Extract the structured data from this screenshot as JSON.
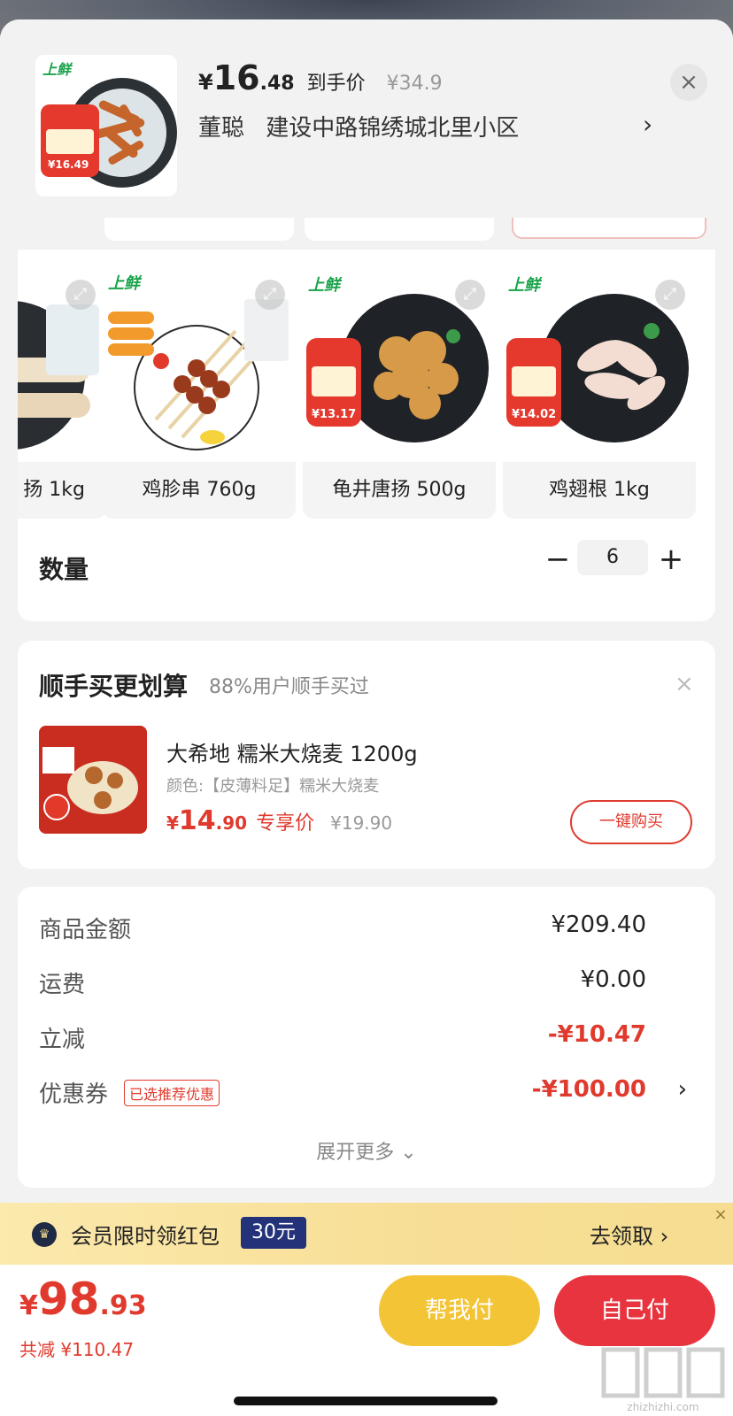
{
  "header": {
    "price_currency": "¥",
    "price_int": "16",
    "price_dec": ".48",
    "price_tag": "到手价",
    "orig_price": "¥34.9",
    "close_glyph": "×",
    "address_name": "董聪",
    "address_detail": "建设中路锦绣城北里小区",
    "chevron": "›",
    "thumb_brand": "上鲜",
    "thumb_badge_price": "¥16.49"
  },
  "products": [
    {
      "name": "扬 1kg",
      "brand": "",
      "badge_price": ""
    },
    {
      "name": "鸡胗串 760g",
      "brand": "上鲜",
      "badge_price": ""
    },
    {
      "name": "龟井唐扬 500g",
      "brand": "上鲜",
      "badge_price": "¥13.17"
    },
    {
      "name": "鸡翅根 1kg",
      "brand": "上鲜",
      "badge_price": "¥14.02"
    }
  ],
  "quantity": {
    "label": "数量",
    "minus": "−",
    "value": "6",
    "plus": "+"
  },
  "upsell": {
    "title": "顺手买更划算",
    "subtitle": "88%用户顺手买过",
    "close_glyph": "×",
    "name": "大希地 糯米大烧麦 1200g",
    "spec": "颜色:【皮薄料足】糯米大烧麦",
    "price_currency": "¥",
    "price_int": "14",
    "price_dec": ".90",
    "price_tag": "专享价",
    "orig_price": "¥19.90",
    "buy_label": "一键购买"
  },
  "summary": {
    "rows": [
      {
        "label": "商品金额",
        "value": "¥209.40"
      },
      {
        "label": "运费",
        "value": "¥0.00"
      },
      {
        "label": "立减",
        "value": "-¥10.47"
      },
      {
        "label": "优惠券",
        "value": "-¥100.00",
        "badge": "已选推荐优惠"
      }
    ],
    "chevron": "›",
    "expand_more": "展开更多 ⌄"
  },
  "member_bar": {
    "text": "会员限时领红包",
    "amount": "30元",
    "go": "去领取 ›",
    "close_glyph": "×",
    "crown_glyph": "♛"
  },
  "bottom": {
    "total_currency": "¥",
    "total_int": "98",
    "total_dec": ".93",
    "total_saved": "共减 ¥110.47",
    "help_pay": "帮我付",
    "self_pay": "自己付"
  },
  "watermark": {
    "text": "zhizhizhi.com"
  },
  "colors": {
    "accent_red": "#e03a2e",
    "pay_red": "#e8343e",
    "help_yellow": "#f4c437",
    "member_gold": "#f7de94",
    "member_navy": "#24327a"
  }
}
